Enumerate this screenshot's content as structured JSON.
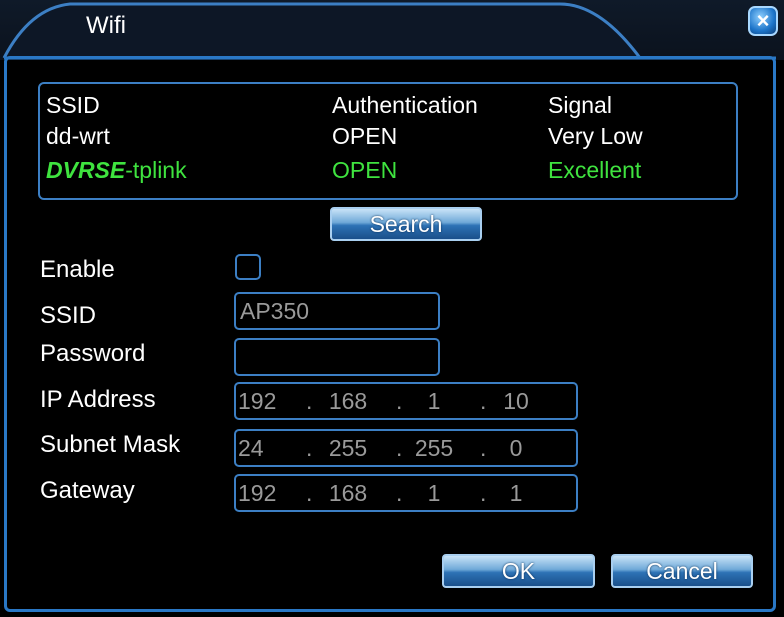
{
  "window": {
    "title": "Wifi",
    "close_label": "×"
  },
  "wifi_list": {
    "headers": {
      "ssid": "SSID",
      "authentication": "Authentication",
      "signal": "Signal"
    },
    "rows": [
      {
        "ssid": "dd-wrt",
        "authentication": "OPEN",
        "signal": "Very Low"
      },
      {
        "ssid_brand": "DVRSE",
        "ssid": "-tplink",
        "authentication": "OPEN",
        "signal": "Excellent"
      }
    ]
  },
  "buttons": {
    "search": "Search",
    "ok": "OK",
    "cancel": "Cancel"
  },
  "form": {
    "enable_label": "Enable",
    "enable_checked": false,
    "ssid_label": "SSID",
    "ssid_value": "AP350",
    "password_label": "Password",
    "password_value": "",
    "ip_label": "IP Address",
    "ip": [
      "192",
      "168",
      "1",
      "10"
    ],
    "mask_label": "Subnet Mask",
    "mask": [
      "24",
      "255",
      "255",
      "0"
    ],
    "gateway_label": "Gateway",
    "gateway": [
      "192",
      "168",
      "1",
      "1"
    ],
    "separator": "."
  },
  "colors": {
    "accent": "#3c7fc4",
    "highlight_green": "#3fe33f",
    "background": "#000000"
  }
}
